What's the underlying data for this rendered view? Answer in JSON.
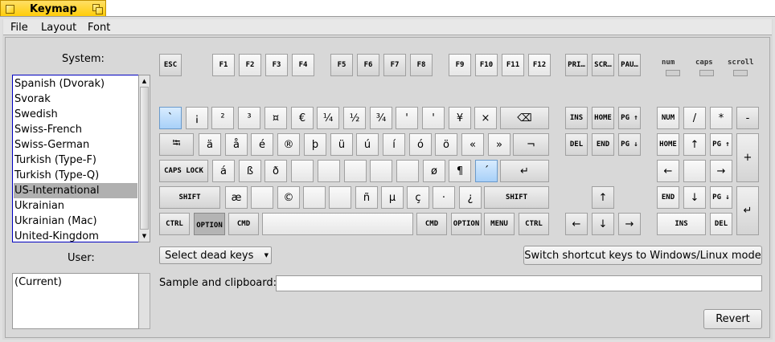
{
  "window": {
    "title": "Keymap"
  },
  "menu": [
    "File",
    "Layout",
    "Font"
  ],
  "system": {
    "label": "System:",
    "items": [
      "Spanish (Dvorak)",
      "Svorak",
      "Swedish",
      "Swiss-French",
      "Swiss-German",
      "Turkish (Type-F)",
      "Turkish (Type-Q)",
      "US-International",
      "Ukrainian",
      "Ukrainian (Mac)",
      "United-Kingdom"
    ],
    "selected": "US-International"
  },
  "user": {
    "label": "User:",
    "items": [
      "(Current)"
    ]
  },
  "keyboard": {
    "frow": [
      "ESC",
      "F1",
      "F2",
      "F3",
      "F4",
      "F5",
      "F6",
      "F7",
      "F8",
      "F9",
      "F10",
      "F11",
      "F12",
      "PRI…",
      "SCR…",
      "PAU…"
    ],
    "row1": [
      "`",
      "¡",
      "²",
      "³",
      "¤",
      "€",
      "¼",
      "½",
      "¾",
      "'",
      "'",
      "¥",
      "×",
      "⌫"
    ],
    "row2": [
      "⭾",
      "ä",
      "å",
      "é",
      "®",
      "þ",
      "ü",
      "ú",
      "í",
      "ó",
      "ö",
      "«",
      "»",
      "¬"
    ],
    "row3": [
      "CAPS LOCK",
      "á",
      "ß",
      "ð",
      "",
      "",
      "",
      "",
      "",
      "ø",
      "¶",
      "´",
      "↵"
    ],
    "row4": [
      "SHIFT",
      "æ",
      "",
      "©",
      "",
      "",
      "ñ",
      "µ",
      "ç",
      "·",
      "¿",
      "SHIFT"
    ],
    "row5": [
      "CTRL",
      "OPTION",
      "CMD",
      "",
      "CMD",
      "OPTION",
      "MENU",
      "CTRL"
    ],
    "nav": [
      "INS",
      "HOME",
      "PG ↑",
      "DEL",
      "END",
      "PG ↓",
      "↑",
      "←",
      "↓",
      "→"
    ],
    "numpad": [
      "NUM",
      "/",
      "*",
      "-",
      "HOME",
      "↑",
      "PG ↑",
      "+",
      "←",
      "",
      "→",
      "END",
      "↓",
      "PG ↓",
      "↵",
      "INS",
      "DEL"
    ],
    "leds": [
      "num",
      "caps",
      "scroll"
    ],
    "highlighted": [
      "`",
      "´"
    ],
    "pressed": [
      "OPTION"
    ]
  },
  "dead_keys": {
    "label": "Select dead keys"
  },
  "switch_button": "Switch shortcut keys to Windows/Linux mode",
  "sample": {
    "label": "Sample and clipboard:",
    "value": ""
  },
  "revert_button": "Revert"
}
